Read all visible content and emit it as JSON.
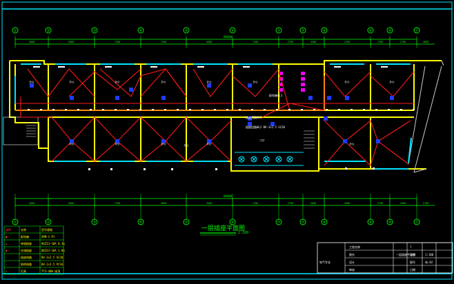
{
  "drawing": {
    "title": "一层插座平面图",
    "scale": "1:100",
    "overall_dim_top": "68400",
    "overall_dim_bottom": "68400",
    "colors": {
      "background": "#000000",
      "frame": "#00e5ff",
      "wall": "#ffff00",
      "wire": "#ff1a1a",
      "outlet": "#1f3bff",
      "axis": "#00ff00",
      "dims": "#00ff00",
      "text": "#ffffff",
      "magenta": "#ff00ff"
    },
    "axes": [
      "①",
      "②",
      "③",
      "④",
      "⑤",
      "⑥",
      "⑦",
      "⑦",
      "⑧",
      "⑨",
      "⑩",
      "⑪"
    ],
    "top_dims": [
      "3000",
      "3600",
      "7200",
      "7200",
      "3600",
      "7200",
      "2700",
      "4500",
      "2700",
      "7200",
      "2700",
      "3000"
    ],
    "bottom_dims": [
      "3600",
      "3600",
      "7200",
      "3600",
      "3600",
      "7200",
      "2700",
      "3600",
      "4500",
      "2700",
      "4500",
      "2700"
    ],
    "room_labels": [
      "办公",
      "办公",
      "办公",
      "办公",
      "办公",
      "办公",
      "办公",
      "办公",
      "办公",
      "办公",
      "办公",
      "办公",
      "办公",
      "办公",
      "门厅"
    ],
    "notes": [
      "配电箱AL1",
      "插座回路WL1",
      "插座回路WL2 BV-3×2.5 SC20"
    ],
    "legend": {
      "headers": [
        "图例",
        "名称",
        "型号规格"
      ],
      "rows": [
        [
          "■",
          "配电箱",
          "XRM-1-P1"
        ],
        [
          "▲",
          "单相插座",
          "86Z13-10A 0.3m"
        ],
        [
          "●",
          "空调插座",
          "86Z13-16A 1.8m"
        ],
        [
          "—",
          "插座线路",
          "BV-3×2.5 SC20"
        ],
        [
          "—",
          "照明线路",
          "BV-2×2.5 PC16"
        ],
        [
          "⊗",
          "灯具",
          "YT3-40W 吸顶"
        ]
      ]
    },
    "title_block": {
      "rows": [
        [
          "工程名称",
          "",
          "?",
          ""
        ],
        [
          "图名",
          "一层插座平面图",
          "比例",
          "1:100"
        ],
        [
          "设计",
          "",
          "图号",
          "电-02"
        ],
        [
          "审核",
          "",
          "日期",
          ""
        ]
      ],
      "left_note": "电气专业"
    }
  }
}
